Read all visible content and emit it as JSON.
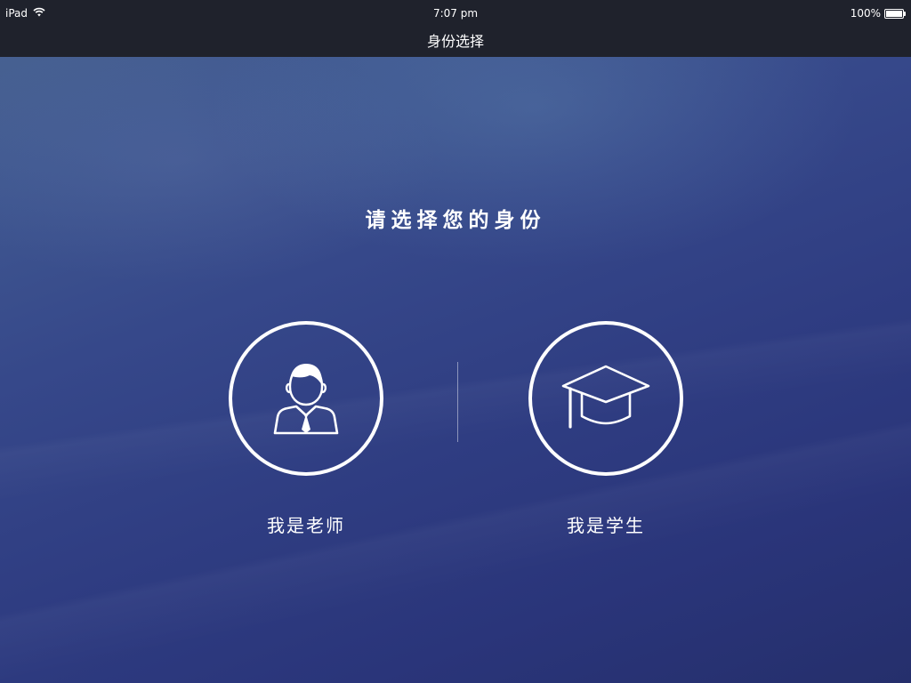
{
  "status_bar": {
    "device": "iPad",
    "wifi_icon": "wifi-icon",
    "time": "7:07 pm",
    "battery_percent": "100%",
    "battery_level": 1.0
  },
  "nav": {
    "title": "身份选择"
  },
  "main": {
    "prompt": "请选择您的身份",
    "roles": [
      {
        "label": "我是老师",
        "icon": "teacher-icon"
      },
      {
        "label": "我是学生",
        "icon": "graduation-cap-icon"
      }
    ]
  },
  "colors": {
    "bar_background": "#1f222c",
    "background_top": "#4a6592",
    "background_bottom": "#252f6c",
    "foreground": "#ffffff"
  }
}
